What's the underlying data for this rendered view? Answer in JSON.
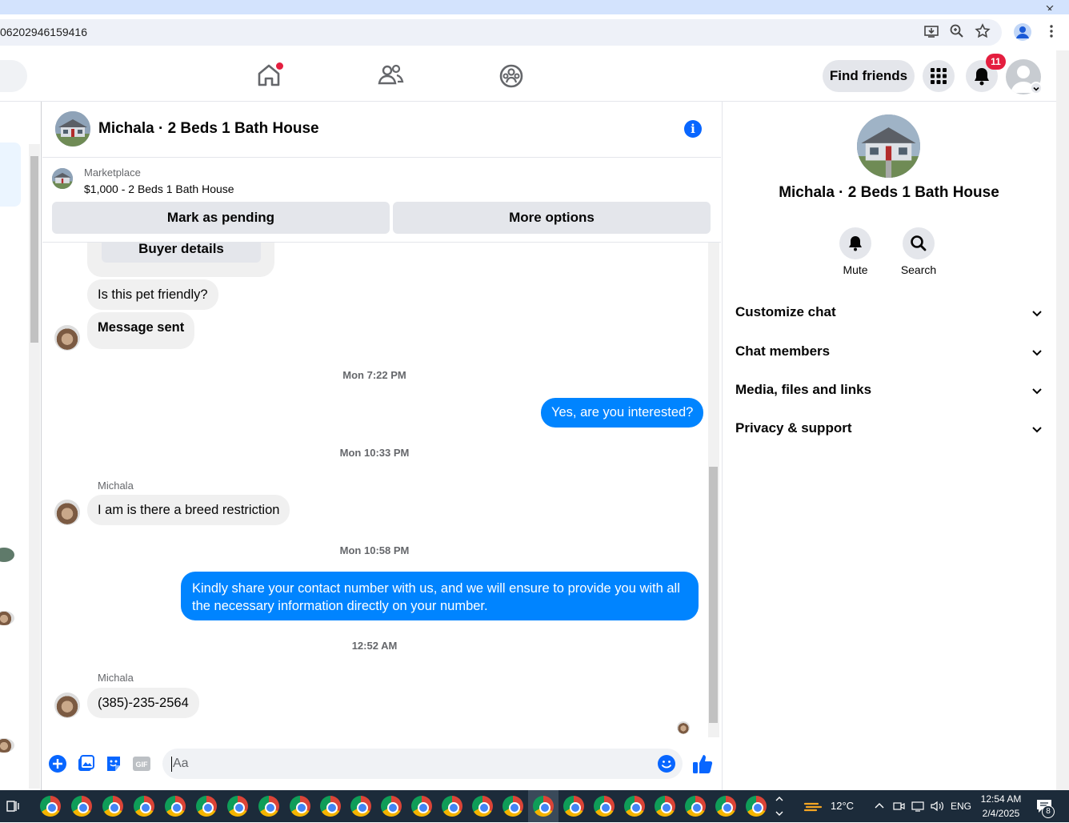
{
  "browser": {
    "url": "06202946159416"
  },
  "nav": {
    "find_friends": "Find friends",
    "notifications_count": "11"
  },
  "chat": {
    "title": "Michala · 2 Beds 1 Bath House",
    "marketplace_label": "Marketplace",
    "listing": "$1,000 - 2 Beds 1 Bath House",
    "mark_pending": "Mark as pending",
    "more_options": "More options",
    "buyer_details": "Buyer details",
    "messages": [
      {
        "type": "in",
        "text": "Is this pet friendly?"
      },
      {
        "type": "in",
        "text": "Message sent"
      },
      {
        "type": "stamp",
        "text": "Mon 7:22 PM"
      },
      {
        "type": "out",
        "text": "Yes, are you interested?"
      },
      {
        "type": "stamp",
        "text": "Mon 10:33 PM"
      },
      {
        "type": "sender",
        "text": "Michala"
      },
      {
        "type": "in",
        "text": "I am is there a breed restriction"
      },
      {
        "type": "stamp",
        "text": "Mon 10:58 PM"
      },
      {
        "type": "out",
        "text": "Kindly share your contact number with us, and we will ensure to provide you with all the necessary information directly on your number."
      },
      {
        "type": "stamp",
        "text": "12:52 AM"
      },
      {
        "type": "sender",
        "text": "Michala"
      },
      {
        "type": "in",
        "text": "(385)-235-2564"
      }
    ],
    "composer_placeholder": "Aa"
  },
  "right_panel": {
    "title": "Michala · 2 Beds 1 Bath House",
    "mute": "Mute",
    "search": "Search",
    "rows": [
      "Customize chat",
      "Chat members",
      "Media, files and links",
      "Privacy & support"
    ]
  },
  "taskbar": {
    "temperature": "12°C",
    "language": "ENG",
    "time": "12:54 AM",
    "date": "2/4/2025",
    "notif_count": "8"
  },
  "colors": {
    "accent": "#0866ff",
    "outgoing_bubble": "#0084ff",
    "badge": "#e41e3f"
  }
}
